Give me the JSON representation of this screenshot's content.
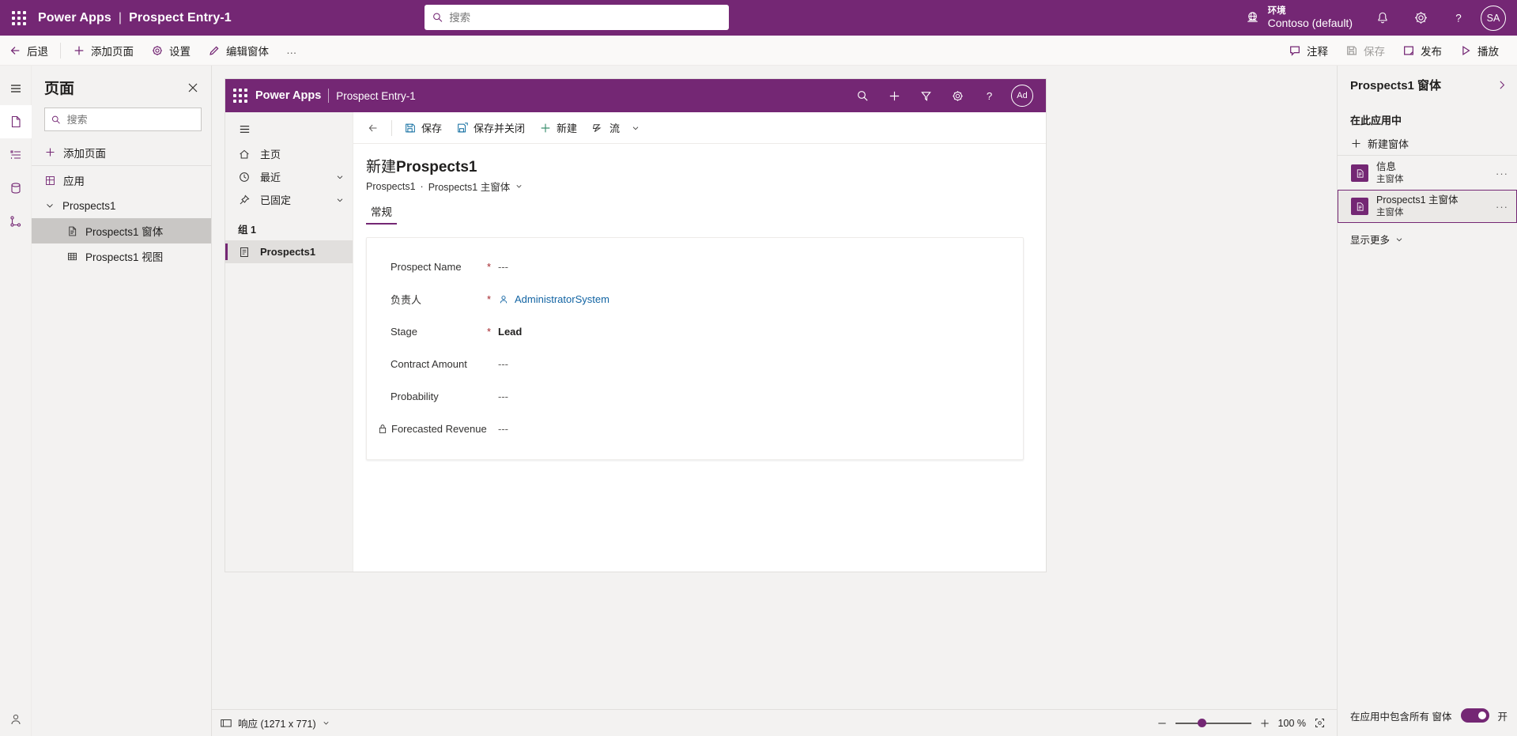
{
  "topbar": {
    "brand": "Power Apps",
    "separator": "|",
    "app_name": "Prospect Entry-1",
    "search_placeholder": "搜索",
    "search_value": "",
    "environment_label": "环境",
    "environment_name": "Contoso (default)",
    "avatar_initials": "SA"
  },
  "commandbar": {
    "back": "后退",
    "add_page": "添加页面",
    "settings": "设置",
    "edit_form": "编辑窗体",
    "overflow": "…",
    "comment": "注释",
    "save": "保存",
    "publish": "发布",
    "play": "播放"
  },
  "pages_panel": {
    "title": "页面",
    "search_placeholder": "搜索",
    "search_value": "",
    "add_page": "添加页面",
    "tree": [
      {
        "label": "应用",
        "icon": "app-icon",
        "level": 0,
        "selected": false
      },
      {
        "label": "Prospects1",
        "icon": "chevron-down-icon",
        "level": 1,
        "selected": false
      },
      {
        "label": "Prospects1 窗体",
        "icon": "form-icon",
        "level": 2,
        "selected": true
      },
      {
        "label": "Prospects1 视图",
        "icon": "grid-icon",
        "level": 2,
        "selected": false
      }
    ]
  },
  "app_preview": {
    "header": {
      "brand": "Power Apps",
      "app_name": "Prospect Entry-1"
    },
    "nav": {
      "items": [
        {
          "label": "主页",
          "icon": "home-icon",
          "chevron": false,
          "selected": false
        },
        {
          "label": "最近",
          "icon": "clock-icon",
          "chevron": true,
          "selected": false
        },
        {
          "label": "已固定",
          "icon": "pin-icon",
          "chevron": true,
          "selected": false
        }
      ],
      "group_label": "组 1",
      "group_items": [
        {
          "label": "Prospects1",
          "icon": "entity-icon",
          "selected": true
        }
      ]
    },
    "form_commands": {
      "save": "保存",
      "save_and_close": "保存并关闭",
      "new": "新建",
      "flow": "流"
    },
    "form": {
      "title_prefix": "新建",
      "title_entity": "Prospects1",
      "breadcrumb_entity": "Prospects1",
      "breadcrumb_sep": "·",
      "breadcrumb_form": "Prospects1 主窗体",
      "tabs": [
        {
          "label": "常规",
          "selected": true
        }
      ],
      "fields": [
        {
          "label": "Prospect Name",
          "required": true,
          "locked": false,
          "value": "---",
          "style": "muted"
        },
        {
          "label": "负责人",
          "required": true,
          "locked": false,
          "value": "AdministratorSystem",
          "style": "link"
        },
        {
          "label": "Stage",
          "required": true,
          "locked": false,
          "value": "Lead",
          "style": "strong"
        },
        {
          "label": "Contract Amount",
          "required": false,
          "locked": false,
          "value": "---",
          "style": "muted"
        },
        {
          "label": "Probability",
          "required": false,
          "locked": false,
          "value": "---",
          "style": "muted"
        },
        {
          "label": "Forecasted Revenue",
          "required": false,
          "locked": true,
          "value": "---",
          "style": "muted"
        }
      ]
    }
  },
  "statusbar": {
    "screen_mode": "响应 (1271 x 771)",
    "zoom_level": "100 %"
  },
  "right_panel": {
    "title": "Prospects1 窗体",
    "section_label": "在此应用中",
    "new_form": "新建窗体",
    "items": [
      {
        "name": "信息",
        "sub": "主窗体",
        "selected": false
      },
      {
        "name": "Prospects1 主窗体",
        "sub": "主窗体",
        "selected": true
      }
    ],
    "show_more": "显示更多",
    "footer_label": "在应用中包含所有 窗体",
    "toggle_state": "开"
  },
  "colors": {
    "brand_purple": "#742774",
    "accent": "#742774",
    "required_red": "#a4262c",
    "link_blue": "#1264a3"
  }
}
